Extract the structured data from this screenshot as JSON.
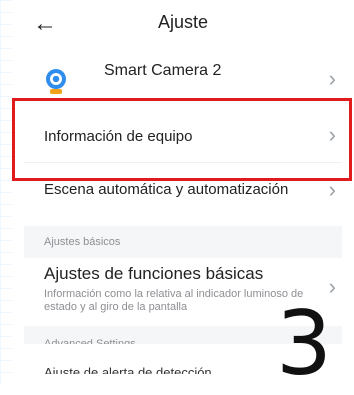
{
  "header": {
    "title": "Ajuste",
    "back_icon": "arrow-left"
  },
  "device": {
    "name": "Smart Camera 2",
    "icon": "camera-icon"
  },
  "rows": {
    "info": {
      "label": "Información de equipo"
    },
    "scene": {
      "label": "Escena automática y automatización"
    },
    "basic": {
      "label": "Ajustes de funciones básicas",
      "desc": "Información como la relativa al indicador luminoso de estado y al giro de la pantalla"
    },
    "bottom": {
      "label": "Ajuste de alerta de detección"
    }
  },
  "sections": {
    "basic": "Ajustes básicos",
    "advanced": "Advanced Settings"
  },
  "annotations": {
    "step_number": "3",
    "highlight_color": "#e11b1b"
  }
}
